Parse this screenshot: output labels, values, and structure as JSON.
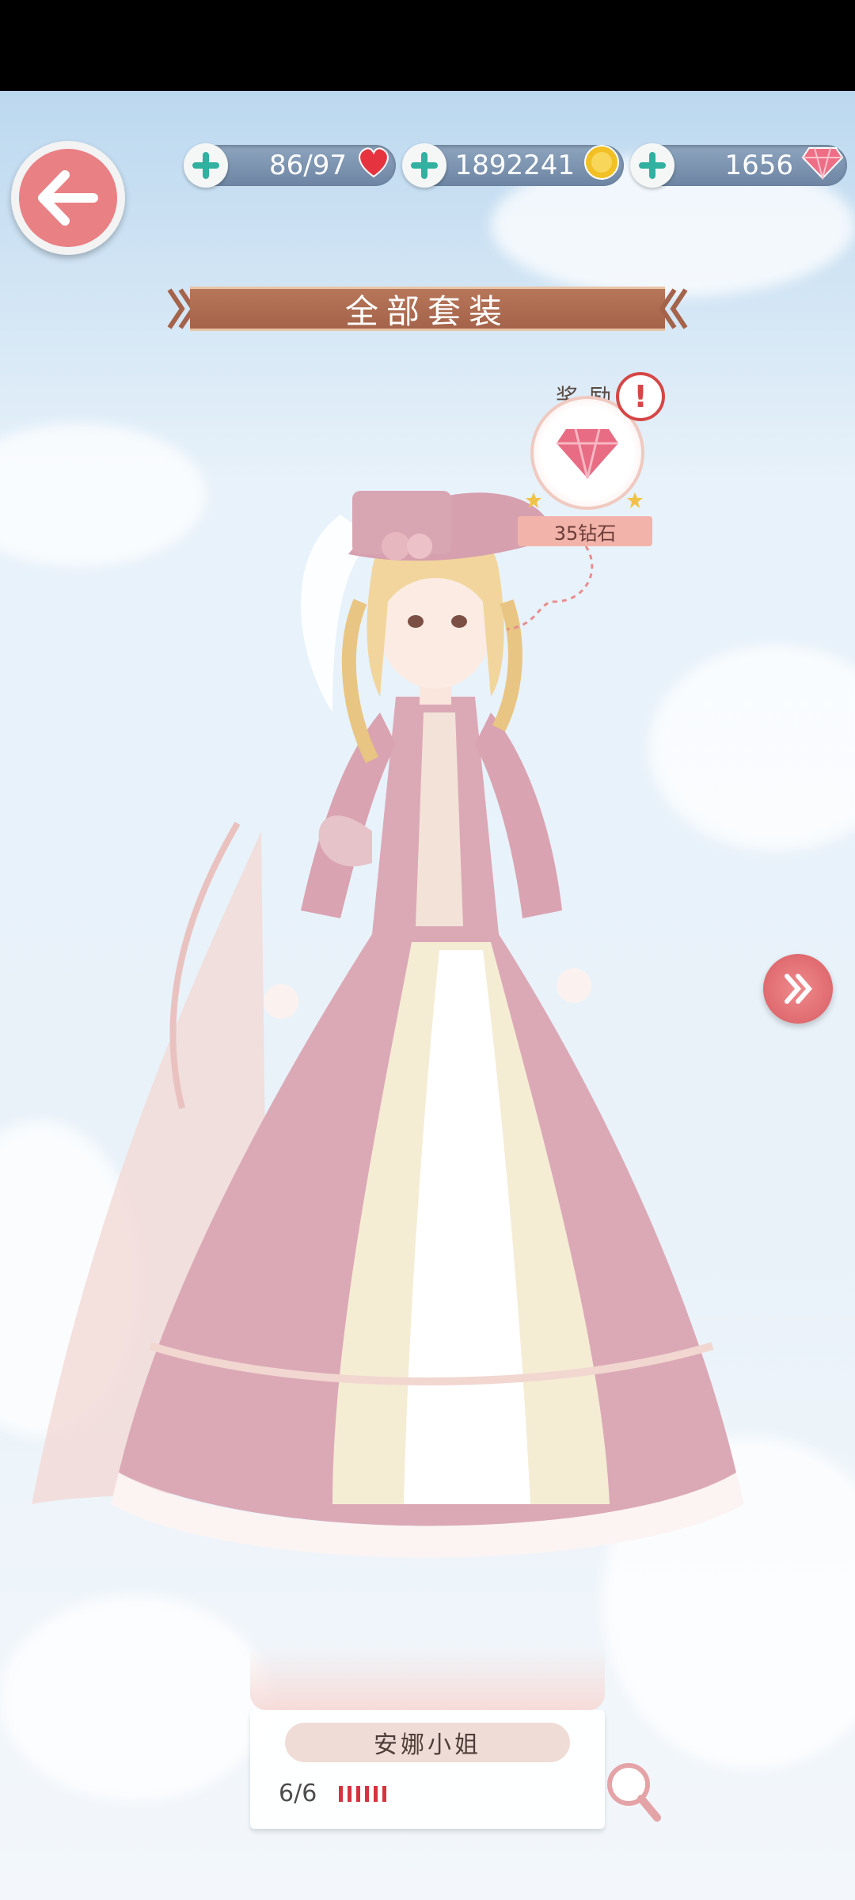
{
  "resources": {
    "stamina": {
      "value": "86/97",
      "icon": "heart-icon"
    },
    "gold": {
      "value": "1892241",
      "icon": "gold-coin-icon"
    },
    "diamonds": {
      "value": "1656",
      "icon": "diamond-icon"
    }
  },
  "banner": {
    "title": "全部套装"
  },
  "reward": {
    "title": "奖励",
    "amount_label": "35钻石"
  },
  "outfit": {
    "name": "安娜小姐",
    "progress_text": "6/6",
    "collected": 6,
    "total": 6
  },
  "colors": {
    "accent": "#e98084",
    "banner": "#a86a4f",
    "resource_bar": "#7c94b1",
    "progress": "#d6333f"
  }
}
